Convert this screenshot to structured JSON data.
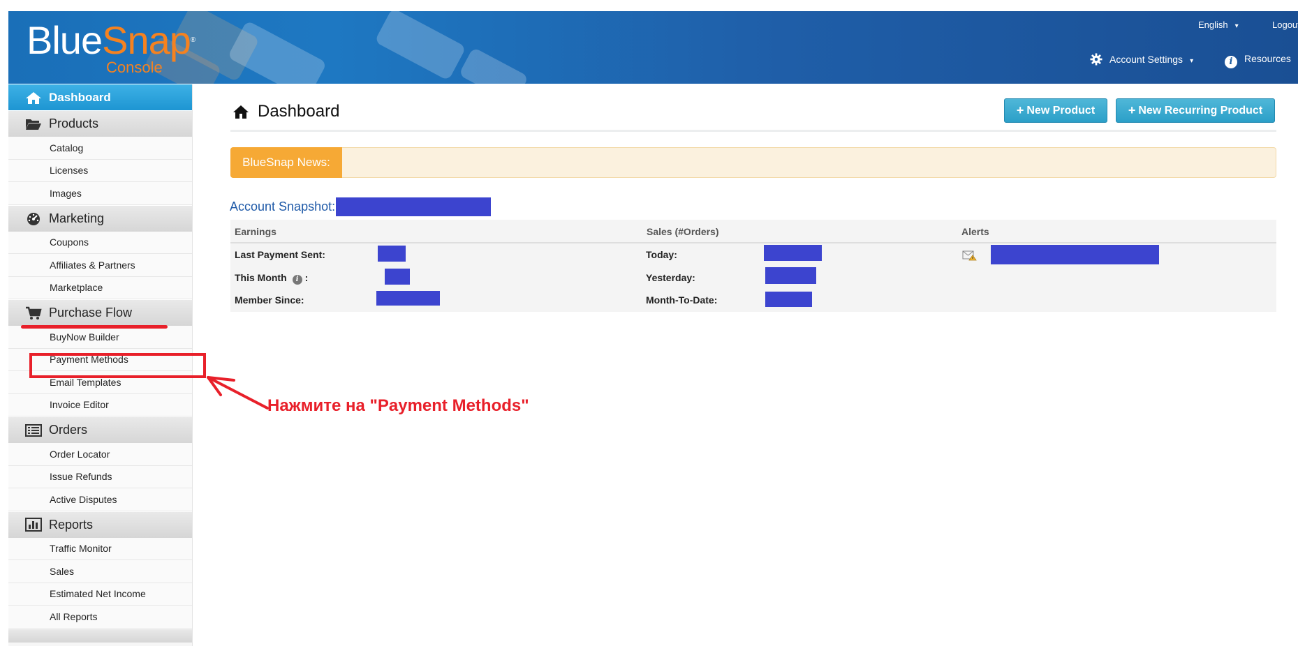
{
  "header": {
    "logo": {
      "part1": "Blue",
      "part2": "Snap",
      "sub": "Console",
      "reg": "®"
    },
    "language": "English",
    "logout": "Logout",
    "account_settings": "Account Settings",
    "resources": "Resources"
  },
  "sidebar": {
    "active": "Dashboard",
    "sections": [
      {
        "title": "Products",
        "icon": "folder-open-icon",
        "items": [
          "Catalog",
          "Licenses",
          "Images"
        ]
      },
      {
        "title": "Marketing",
        "icon": "dashboard-gauge-icon",
        "items": [
          "Coupons",
          "Affiliates & Partners",
          "Marketplace"
        ]
      },
      {
        "title": "Purchase Flow",
        "icon": "shopping-cart-icon",
        "items": [
          "BuyNow Builder",
          "Payment Methods",
          "Email Templates",
          "Invoice Editor"
        ]
      },
      {
        "title": "Orders",
        "icon": "list-icon",
        "items": [
          "Order Locator",
          "Issue Refunds",
          "Active Disputes"
        ]
      },
      {
        "title": "Reports",
        "icon": "bar-chart-icon",
        "items": [
          "Traffic Monitor",
          "Sales",
          "Estimated Net Income",
          "All Reports"
        ]
      }
    ]
  },
  "main": {
    "title": "Dashboard",
    "buttons": {
      "new_product": "New Product",
      "new_recurring": "New Recurring Product"
    },
    "news_label": "BlueSnap News:",
    "snapshot_title": "Account Snapshot:",
    "table": {
      "headers": {
        "earnings": "Earnings",
        "sales": "Sales (#Orders)",
        "alerts": "Alerts"
      },
      "earnings_rows": [
        "Last Payment Sent:",
        "This Month",
        "Member Since:"
      ],
      "this_month_suffix": ":",
      "sales_rows": [
        "Today:",
        "Yesterday:",
        "Month-To-Date:"
      ]
    }
  },
  "annotation": {
    "text": "Нажмите на \"Payment Methods\"",
    "color": "#e8202a"
  },
  "colors": {
    "header_blue": "#1e78c2",
    "accent_orange": "#f58220",
    "active_blue": "#1e95d2",
    "button_teal": "#2b9fc8",
    "redaction": "#3c44cf",
    "annotation_red": "#e8202a"
  }
}
